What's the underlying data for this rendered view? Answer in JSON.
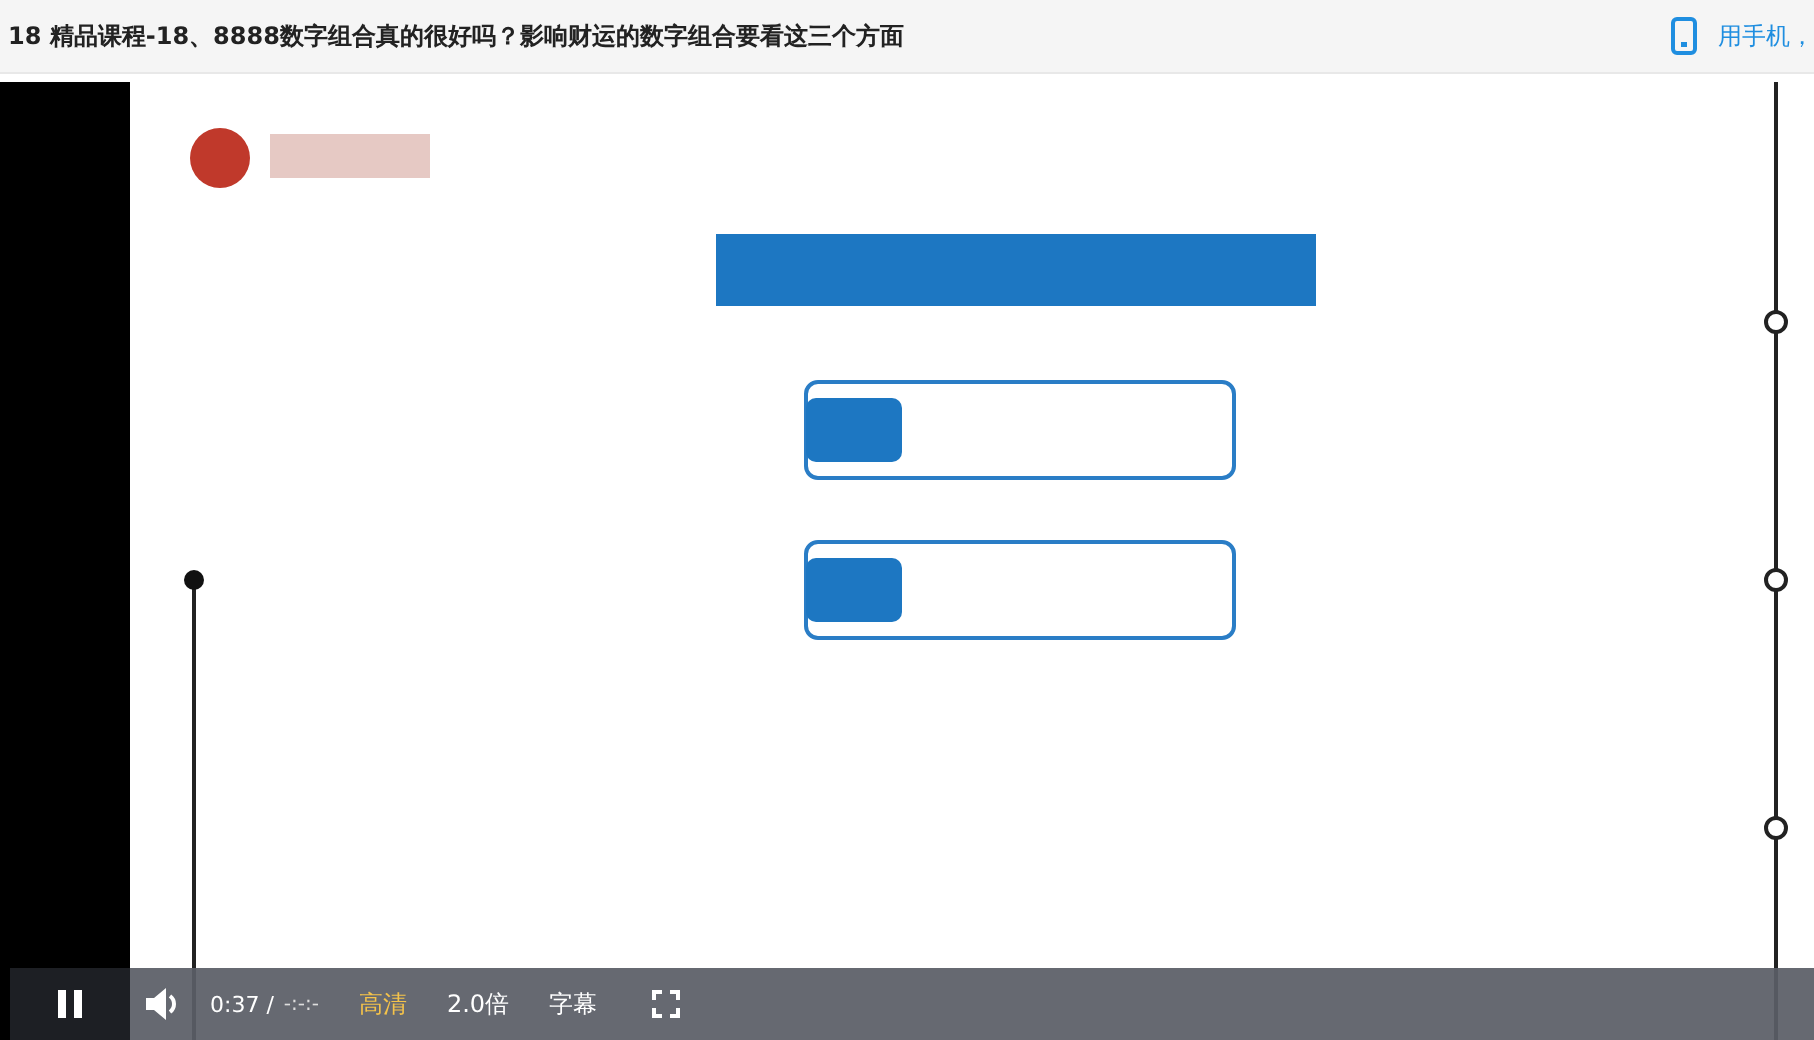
{
  "header": {
    "title": "18 精品课程-18、8888数字组合真的很好吗？影响财运的数字组合要看这三个方面",
    "mobile_link": "用手机，"
  },
  "player": {
    "controls": {
      "time": "0:37 /",
      "duration": "-:-:-",
      "quality": "高清",
      "speed": "2.0倍",
      "subtitles": "字幕"
    }
  }
}
